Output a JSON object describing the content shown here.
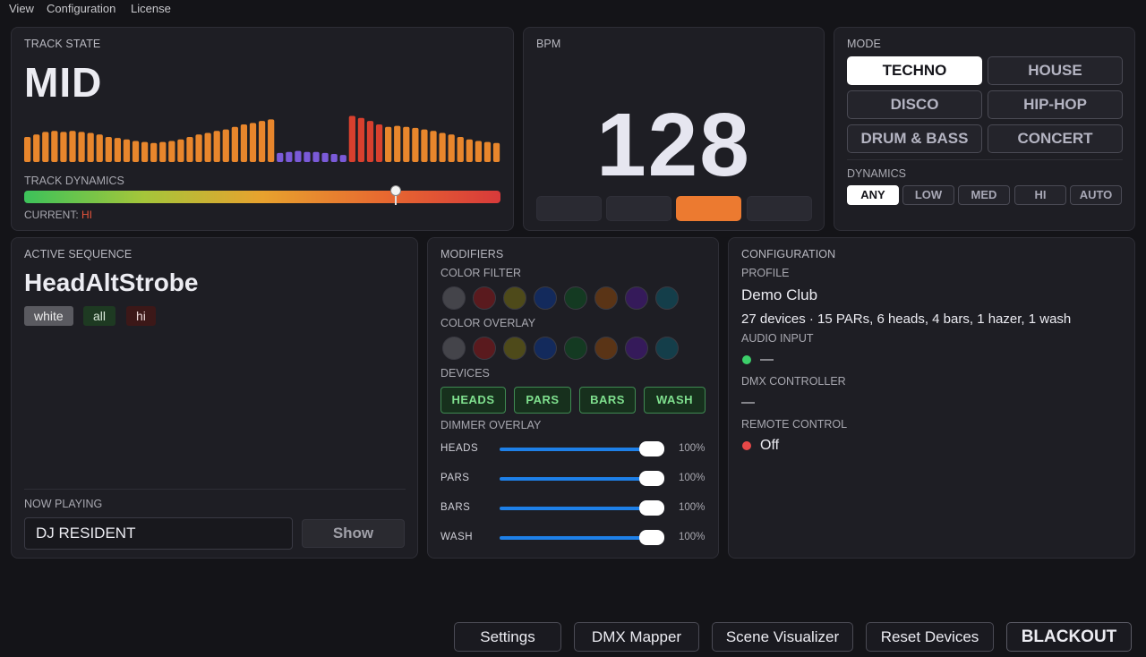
{
  "menubar": {
    "items": [
      "View",
      "Configuration",
      "License"
    ]
  },
  "track_state": {
    "title": "TRACK STATE",
    "value": "MID",
    "meter_levels": [
      0.5,
      0.55,
      0.6,
      0.62,
      0.6,
      0.62,
      0.6,
      0.58,
      0.55,
      0.5,
      0.48,
      0.45,
      0.42,
      0.4,
      0.38,
      0.4,
      0.42,
      0.45,
      0.5,
      0.55,
      0.58,
      0.62,
      0.65,
      0.7,
      0.75,
      0.78,
      0.82,
      0.85,
      0.18,
      0.2,
      0.22,
      0.2,
      0.2,
      0.18,
      0.16,
      0.14,
      0.92,
      0.88,
      0.82,
      0.75,
      0.7,
      0.72,
      0.7,
      0.68,
      0.65,
      0.62,
      0.58,
      0.55,
      0.5,
      0.45,
      0.42,
      0.4,
      0.38
    ],
    "meter_colors": {
      "orange": "#e8862c",
      "purple": "#7a5ad8",
      "red": "#d8402e"
    },
    "dynamics_label": "TRACK DYNAMICS",
    "dynamics_level": 0.78,
    "current_label": "CURRENT:",
    "current_value": "HI"
  },
  "bpm": {
    "title": "BPM",
    "value": "128",
    "beats": [
      false,
      false,
      true,
      false
    ],
    "beat_color": "#ec7a30"
  },
  "mode": {
    "title": "MODE",
    "options": [
      "TECHNO",
      "HOUSE",
      "DISCO",
      "HIP-HOP",
      "DRUM & BASS",
      "CONCERT"
    ],
    "active": "TECHNO",
    "dynamics_title": "DYNAMICS",
    "dynamics_options": [
      "ANY",
      "LOW",
      "MED",
      "HI",
      "AUTO"
    ],
    "dynamics_active": "ANY"
  },
  "sequence": {
    "title": "ACTIVE SEQUENCE",
    "name": "HeadAltStrobe",
    "tags": [
      "white",
      "all",
      "hi"
    ],
    "now_playing_label": "NOW PLAYING",
    "now_playing_value": "DJ RESIDENT",
    "show_label": "Show"
  },
  "modifiers": {
    "title": "MODIFIERS",
    "color_filter_label": "COLOR FILTER",
    "color_overlay_label": "COLOR OVERLAY",
    "swatch_colors": [
      "#44444a",
      "#5a1a1e",
      "#4e4a1a",
      "#132a5c",
      "#143a22",
      "#5a3416",
      "#351a5a",
      "#143e4a"
    ],
    "devices_label": "DEVICES",
    "devices": [
      "HEADS",
      "PARS",
      "BARS",
      "WASH"
    ],
    "dimmer_label": "DIMMER OVERLAY",
    "dimmers": [
      {
        "name": "HEADS",
        "value": "100%"
      },
      {
        "name": "PARS",
        "value": "100%"
      },
      {
        "name": "BARS",
        "value": "100%"
      },
      {
        "name": "WASH",
        "value": "100%"
      }
    ],
    "accent": "#1e80e8",
    "device_color": "#7fe08e"
  },
  "configuration": {
    "title": "CONFIGURATION",
    "profile_label": "PROFILE",
    "profile_value": "Demo Club",
    "devices_summary": "27 devices  ·  15 PARs, 6 heads, 4 bars, 1 hazer, 1 wash",
    "audio_label": "AUDIO INPUT",
    "audio_value": "—",
    "audio_status_color": "#3ccf6a",
    "dmx_label": "DMX CONTROLLER",
    "dmx_value": "—",
    "remote_label": "REMOTE CONTROL",
    "remote_value": "Off",
    "remote_status_color": "#e84848"
  },
  "footer": {
    "buttons": [
      "Settings",
      "DMX Mapper",
      "Scene Visualizer",
      "Reset Devices",
      "BLACKOUT"
    ]
  }
}
